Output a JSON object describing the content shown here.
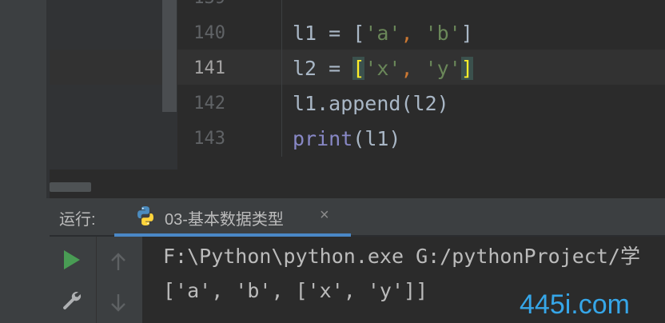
{
  "editor": {
    "lines": [
      {
        "num": "140",
        "tokens": {
          "a": "l1 = [",
          "b": "'a'",
          "c": ", ",
          "d": "'b'",
          "e": "]"
        }
      },
      {
        "num": "141",
        "tokens": {
          "a": "l2 = ",
          "b": "[",
          "c": "'x'",
          "d": ", ",
          "e": "'y'",
          "f": "]"
        }
      },
      {
        "num": "142",
        "text": "l1.append(l2)"
      },
      {
        "num": "143",
        "tokens": {
          "a": "print",
          "b": "(l1)"
        }
      }
    ]
  },
  "run_panel": {
    "title": "运行:",
    "tab_label": "03-基本数据类型",
    "tab_close": "×"
  },
  "console": {
    "lines": [
      "F:\\Python\\python.exe G:/pythonProject/学",
      "['a', 'b', ['x', 'y']]"
    ]
  },
  "watermark": "445i.com",
  "colors": {
    "accent": "#4a88c7",
    "run_green": "#499c54",
    "string_green": "#6a8759",
    "bracket_highlight": "#ffef28"
  },
  "icons": [
    "python-icon",
    "run-icon",
    "wrench-icon",
    "arrow-up-icon",
    "arrow-down-icon",
    "close-icon"
  ]
}
